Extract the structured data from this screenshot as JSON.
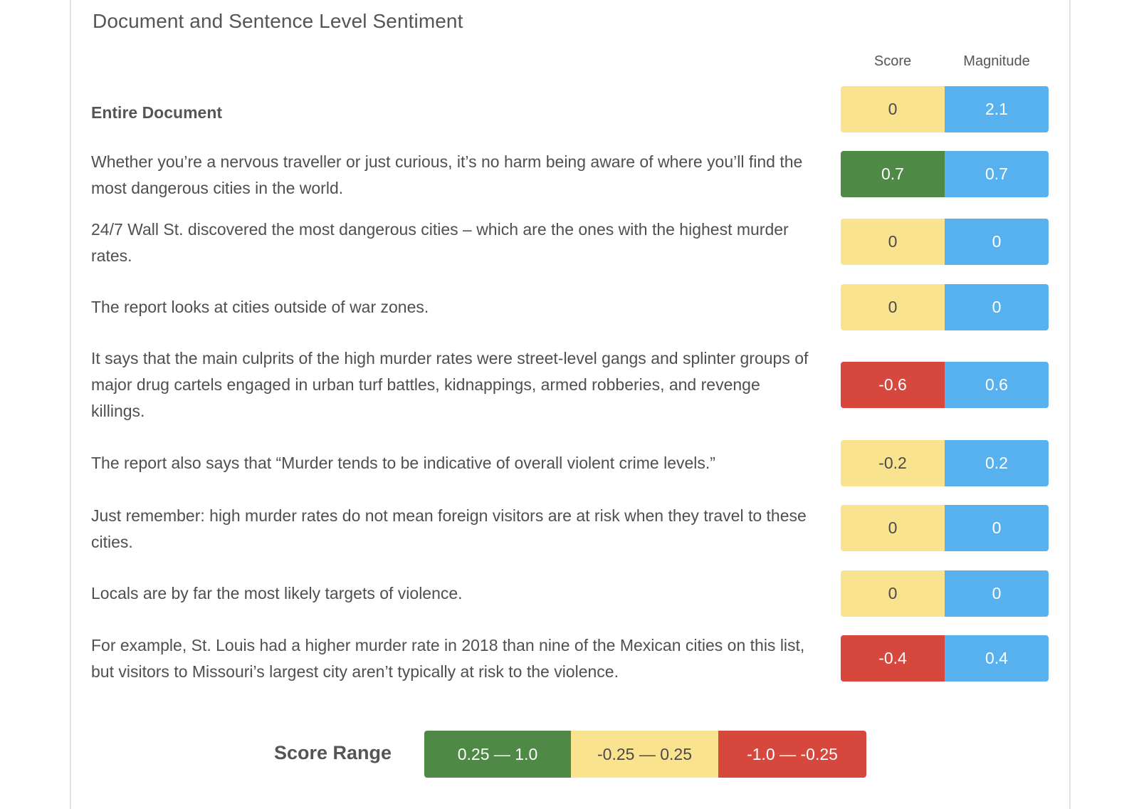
{
  "title": "Document and Sentence Level Sentiment",
  "columns": {
    "score": "Score",
    "magnitude": "Magnitude"
  },
  "colors": {
    "positive": "#4e8a46",
    "neutral": "#fae38f",
    "negative": "#d6483e",
    "magnitude": "#58b1ef"
  },
  "entire_document": {
    "label": "Entire Document",
    "score": "0",
    "score_class": "neutral",
    "magnitude": "2.1"
  },
  "sentences": [
    {
      "text": "Whether you’re a nervous traveller or just curious, it’s no harm being aware of where you’ll find the most dangerous cities in the world.",
      "score": "0.7",
      "score_class": "positive",
      "magnitude": "0.7"
    },
    {
      "text": "24/7 Wall St. discovered the most dangerous cities – which are the ones with the highest murder rates.",
      "score": "0",
      "score_class": "neutral",
      "magnitude": "0"
    },
    {
      "text": "The report looks at cities outside of war zones.",
      "score": "0",
      "score_class": "neutral",
      "magnitude": "0"
    },
    {
      "text": "It says that the main culprits of the high murder rates were street-level gangs and splinter groups of major drug cartels engaged in urban turf battles, kidnappings, armed robberies, and revenge killings.",
      "score": "-0.6",
      "score_class": "negative",
      "magnitude": "0.6"
    },
    {
      "text": "The report also says that “Murder tends to be indicative of overall violent crime levels.”",
      "score": "-0.2",
      "score_class": "neutral",
      "magnitude": "0.2"
    },
    {
      "text": "Just remember: high murder rates do not mean foreign visitors are at risk when they travel to these cities.",
      "score": "0",
      "score_class": "neutral",
      "magnitude": "0"
    },
    {
      "text": "Locals are by far the most likely targets of violence.",
      "score": "0",
      "score_class": "neutral",
      "magnitude": "0"
    },
    {
      "text": "For example, St. Louis had a higher murder rate in 2018 than nine of the Mexican cities on this list, but visitors to Missouri’s largest city aren’t typically at risk to the violence.",
      "score": "-0.4",
      "score_class": "negative",
      "magnitude": "0.4"
    }
  ],
  "score_range": {
    "label": "Score Range",
    "segments": [
      {
        "label": "0.25 — 1.0",
        "class": "positive"
      },
      {
        "label": "-0.25 — 0.25",
        "class": "neutral"
      },
      {
        "label": "-1.0 — -0.25",
        "class": "negative"
      }
    ]
  }
}
